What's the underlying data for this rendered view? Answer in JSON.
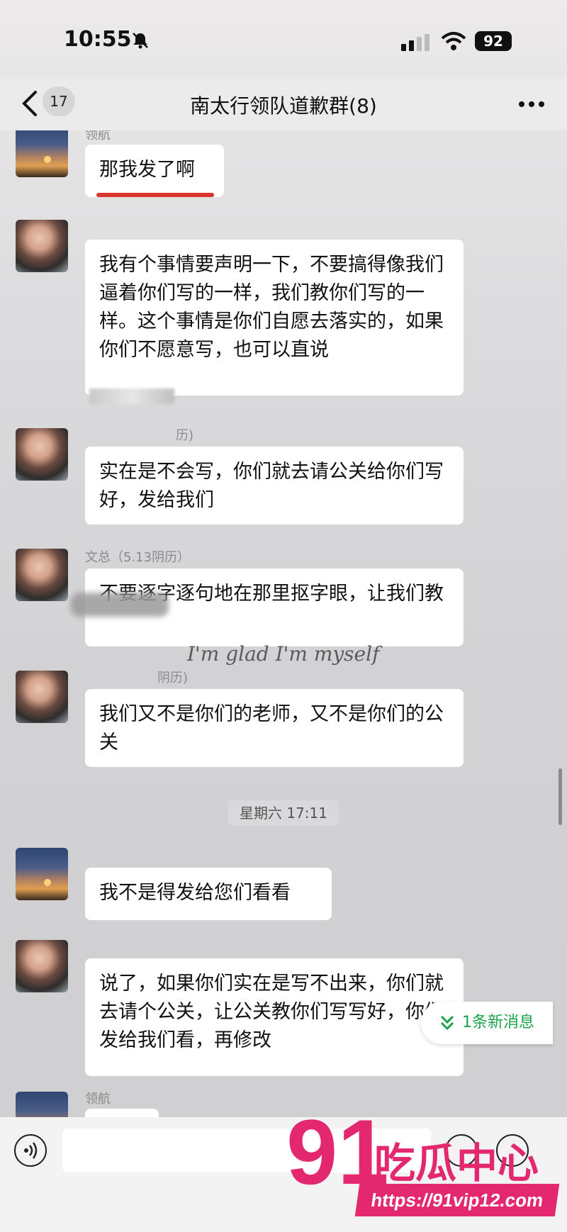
{
  "status_bar": {
    "time": "10:55",
    "battery": "92"
  },
  "nav": {
    "unread_count": "17",
    "title": "南太行领队道歉群(8)"
  },
  "chat": {
    "messages": [
      {
        "sender": "领航",
        "text": "那我发了啊",
        "avatar": "sunset"
      },
      {
        "sender": "",
        "text": "我有个事情要声明一下，不要搞得像我们逼着你们写的一样，我们教你们写的一样。这个事情是你们自愿去落实的，如果你们不愿意写，也可以直说",
        "avatar": "girl"
      },
      {
        "sender": "历)",
        "text": "实在是不会写，你们就去请公关给你们写好，发给我们",
        "avatar": "girl"
      },
      {
        "sender": "文总（5.13阴历）",
        "text": "不要逐字逐句地在那里抠字眼，让我们教",
        "avatar": "girl"
      },
      {
        "sender": "阴历)",
        "text": "我们又不是你们的老师，又不是你们的公关",
        "avatar": "girl"
      },
      {
        "sender": "",
        "text": "我不是得发给您们看看",
        "avatar": "sunset"
      },
      {
        "sender": "",
        "text": "说了，如果你们实在是写不出来，你们就去请个公关，让公关教你们写写好，你们发给我们看，再修改",
        "avatar": "girl"
      },
      {
        "sender": "领航",
        "text": "",
        "avatar": "sunset"
      }
    ],
    "timestamp": "星期六 17:11",
    "overlay_text": "I'm glad I'm myself",
    "new_message_pill": "1条新消息"
  },
  "input": {
    "placeholder": ""
  },
  "watermark": {
    "number": "91",
    "cn": "吃瓜中心",
    "url": "https://91vip12.com"
  },
  "colors": {
    "bubble": "#ffffff",
    "new_msg": "#1aa34a",
    "watermark": "#e4286f",
    "annotation_line": "#d8362b"
  },
  "icons": [
    "bell-slash-icon",
    "signal-icon",
    "wifi-icon",
    "battery-icon",
    "back-chevron-icon",
    "more-icon",
    "double-chevron-down-icon",
    "voice-icon",
    "emoji-icon",
    "plus-icon"
  ]
}
